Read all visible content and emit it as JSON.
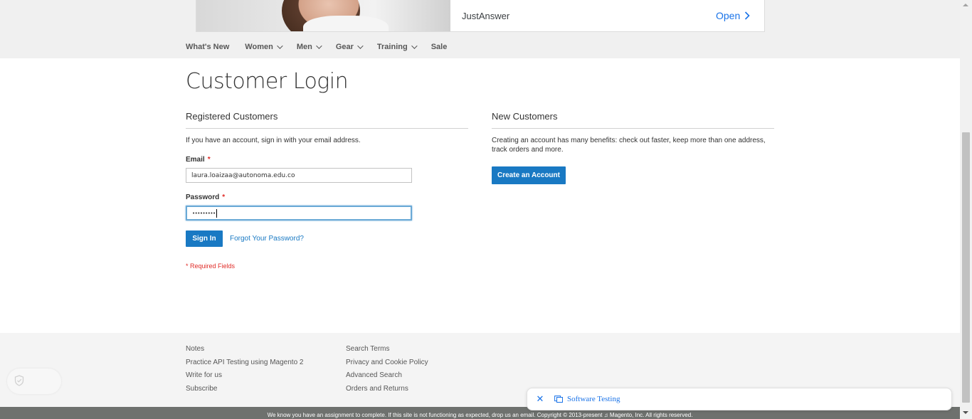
{
  "ad": {
    "advertiser": "JustAnswer",
    "open_label": "Open"
  },
  "nav": {
    "items": [
      {
        "label": "What's New",
        "dropdown": false
      },
      {
        "label": "Women",
        "dropdown": true
      },
      {
        "label": "Men",
        "dropdown": true
      },
      {
        "label": "Gear",
        "dropdown": true
      },
      {
        "label": "Training",
        "dropdown": true
      },
      {
        "label": "Sale",
        "dropdown": false
      }
    ]
  },
  "page_title": "Customer Login",
  "registered": {
    "title": "Registered Customers",
    "intro": "If you have an account, sign in with your email address.",
    "email_label": "Email",
    "email_value": "laura.loaizaa@autonoma.edu.co",
    "password_label": "Password",
    "password_value": "•••••••••",
    "required_marker": "*",
    "sign_in_label": "Sign In",
    "forgot_label": "Forgot Your Password?",
    "required_note": "* Required Fields"
  },
  "new_customers": {
    "title": "New Customers",
    "text": "Creating an account has many benefits: check out faster, keep more than one address, track orders and more.",
    "create_label": "Create an Account"
  },
  "footer": {
    "col1": [
      "Notes",
      "Practice API Testing using Magento 2",
      "Write for us",
      "Subscribe"
    ],
    "col2": [
      "Search Terms",
      "Privacy and Cookie Policy",
      "Advanced Search",
      "Orders and Returns"
    ],
    "copyright": "We know you have an assignment to complete. If this site is not functioning as expected, drop us an email. Copyright © 2013-present ♫ Magento, Inc. All rights reserved."
  },
  "toast": {
    "close_icon": "close-icon",
    "label": "Software Testing"
  },
  "colors": {
    "primary": "#1979c3",
    "required": "#e02b27",
    "link_blue": "#1a73e8"
  }
}
